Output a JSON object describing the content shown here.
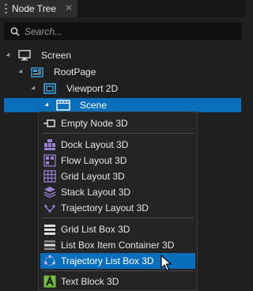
{
  "tab": {
    "title": "Node Tree",
    "close": "✕"
  },
  "search": {
    "placeholder": "Search..."
  },
  "tree": {
    "screen": "Screen",
    "root_page": "RootPage",
    "viewport": "Viewport 2D",
    "scene": "Scene"
  },
  "menu": {
    "items": [
      {
        "label": "Empty Node 3D",
        "icon": "empty-node-icon"
      },
      {
        "label": "Dock Layout 3D",
        "icon": "dock-layout-icon"
      },
      {
        "label": "Flow Layout 3D",
        "icon": "flow-layout-icon"
      },
      {
        "label": "Grid Layout 3D",
        "icon": "grid-layout-icon"
      },
      {
        "label": "Stack Layout 3D",
        "icon": "stack-layout-icon"
      },
      {
        "label": "Trajectory Layout 3D",
        "icon": "trajectory-layout-icon"
      },
      {
        "label": "Grid List Box 3D",
        "icon": "grid-list-box-icon"
      },
      {
        "label": "List Box Item Container 3D",
        "icon": "list-box-item-container-icon"
      },
      {
        "label": "Trajectory List Box 3D",
        "icon": "trajectory-list-box-icon"
      },
      {
        "label": "Text Block 3D",
        "icon": "text-block-icon"
      }
    ],
    "highlighted_index": 8
  },
  "colors": {
    "selection": "#0a6fba",
    "background": "#1f1f1f",
    "menu": "#242424"
  }
}
